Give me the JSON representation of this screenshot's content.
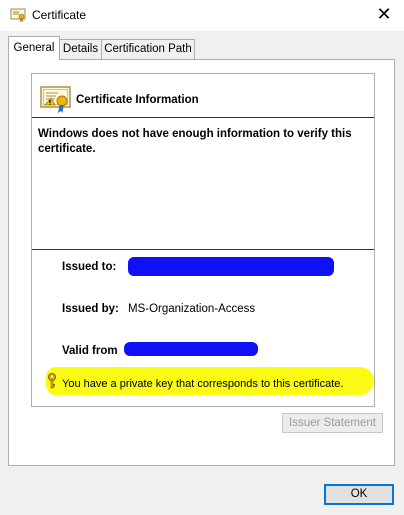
{
  "window": {
    "title": "Certificate",
    "close_label": "✕"
  },
  "tabs": [
    {
      "label": "General",
      "active": true
    },
    {
      "label": "Details",
      "active": false
    },
    {
      "label": "Certification Path",
      "active": false
    }
  ],
  "general": {
    "info_title": "Certificate Information",
    "warning": "Windows does not have enough information to verify this certificate.",
    "issued_to_label": "Issued to:",
    "issued_by_label": "Issued by:",
    "issued_by_value": "MS-Organization-Access",
    "valid_from_label": "Valid from",
    "private_key_note": "You have a private key that corresponds to this certificate.",
    "issuer_statement_label": "Issuer Statement"
  },
  "buttons": {
    "ok_label": "OK"
  },
  "colors": {
    "redaction": "#1010f5",
    "highlight": "#fafa14"
  }
}
